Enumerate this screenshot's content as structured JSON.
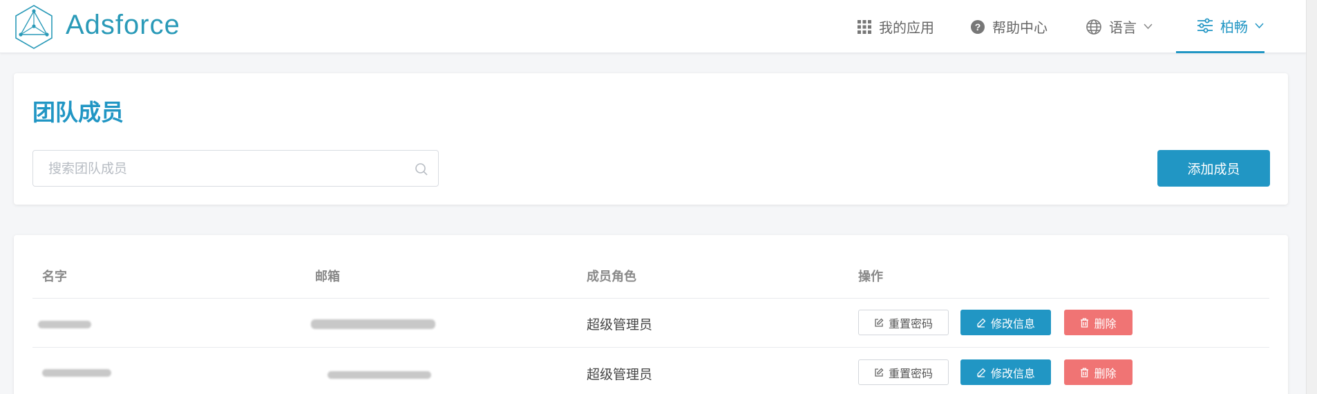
{
  "header": {
    "brand": "Adsforce",
    "nav": {
      "apps_label": "我的应用",
      "help_label": "帮助中心",
      "language_label": "语言",
      "user_label": "柏畅"
    }
  },
  "team": {
    "title": "团队成员",
    "search_placeholder": "搜索团队成员",
    "add_button_label": "添加成员"
  },
  "table": {
    "columns": {
      "name": "名字",
      "email": "邮箱",
      "role": "成员角色",
      "actions": "操作"
    },
    "rows": [
      {
        "role": "超级管理员"
      },
      {
        "role": "超级管理员"
      }
    ],
    "actions": {
      "reset_password": "重置密码",
      "edit_info": "修改信息",
      "delete": "删除"
    }
  },
  "colors": {
    "accent": "#2196c4",
    "brand": "#2a9ab8",
    "danger": "#f07474"
  },
  "icons": [
    "logo-icon",
    "apps-grid-icon",
    "help-icon",
    "globe-icon",
    "settings-sliders-icon",
    "chevron-down-icon",
    "search-icon",
    "edit-square-icon",
    "pen-icon",
    "trash-icon"
  ]
}
